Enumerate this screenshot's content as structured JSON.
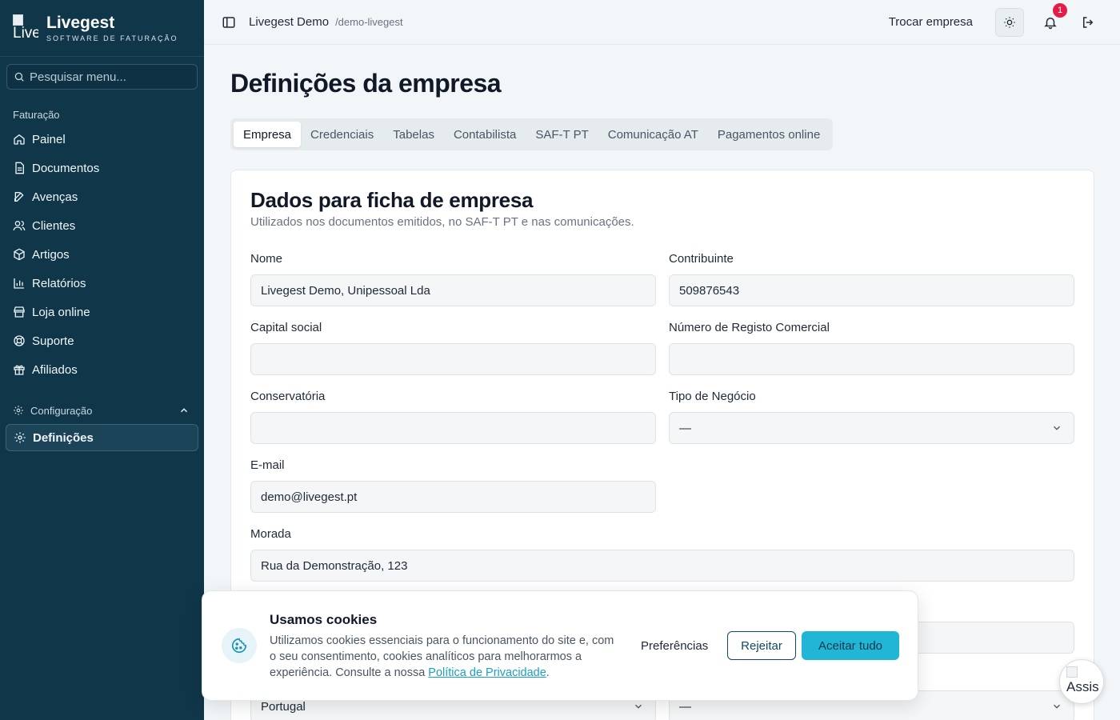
{
  "brand": {
    "name": "Livegest",
    "tagline": "SOFTWARE DE FATURAÇÃO",
    "logo_alt": "Live"
  },
  "sidebar": {
    "search_placeholder": "Pesquisar menu...",
    "section_label": "Faturação",
    "items": [
      {
        "label": "Painel",
        "icon": "home-icon"
      },
      {
        "label": "Documentos",
        "icon": "document-icon"
      },
      {
        "label": "Avenças",
        "icon": "edit-icon"
      },
      {
        "label": "Clientes",
        "icon": "users-icon"
      },
      {
        "label": "Artigos",
        "icon": "package-icon"
      },
      {
        "label": "Relatórios",
        "icon": "bar-chart-icon"
      },
      {
        "label": "Loja online",
        "icon": "store-icon"
      },
      {
        "label": "Suporte",
        "icon": "lifebuoy-icon"
      },
      {
        "label": "Afiliados",
        "icon": "gift-icon"
      }
    ],
    "config_label": "Configuração",
    "active_item": "Definições"
  },
  "topbar": {
    "workspace": "Livegest Demo",
    "slug": "/demo-livegest",
    "switch_label": "Trocar empresa",
    "notification_count": "1"
  },
  "page": {
    "title": "Definições da empresa",
    "tabs": [
      "Empresa",
      "Credenciais",
      "Tabelas",
      "Contabilista",
      "SAF-T PT",
      "Comunicação AT",
      "Pagamentos online"
    ],
    "active_tab": "Empresa"
  },
  "card": {
    "title": "Dados para ficha de empresa",
    "subtitle": "Utilizados nos documentos emitidos, no SAF-T PT e nas comunicações.",
    "fields": {
      "nome": {
        "label": "Nome",
        "value": "Livegest Demo, Unipessoal Lda"
      },
      "contribuinte": {
        "label": "Contribuinte",
        "value": "509876543"
      },
      "capital": {
        "label": "Capital social",
        "value": ""
      },
      "registo": {
        "label": "Número de Registo Comercial",
        "value": ""
      },
      "conservatoria": {
        "label": "Conservatória",
        "value": ""
      },
      "tipo": {
        "label": "Tipo de Negócio",
        "value": "—"
      },
      "email": {
        "label": "E-mail",
        "value": "demo@livegest.pt"
      },
      "morada": {
        "label": "Morada",
        "value": "Rua da Demonstração, 123"
      },
      "pais": {
        "value": "Portugal"
      },
      "extra": {
        "value": "—"
      }
    }
  },
  "cookies": {
    "title": "Usamos cookies",
    "text": "Utilizamos cookies essenciais para o funcionamento do site e, com o seu consentimento, cookies analíticos para melhorarmos a experiência. Consulte a nossa ",
    "link": "Política de Privacidade",
    "text_end": ".",
    "preferences": "Preferências",
    "reject": "Rejeitar",
    "accept": "Aceitar tudo"
  },
  "assistant": {
    "alt": "Assis"
  },
  "colors": {
    "sidebar_bg": "#103649",
    "accent": "#21b5d6",
    "badge": "#e11d48"
  }
}
